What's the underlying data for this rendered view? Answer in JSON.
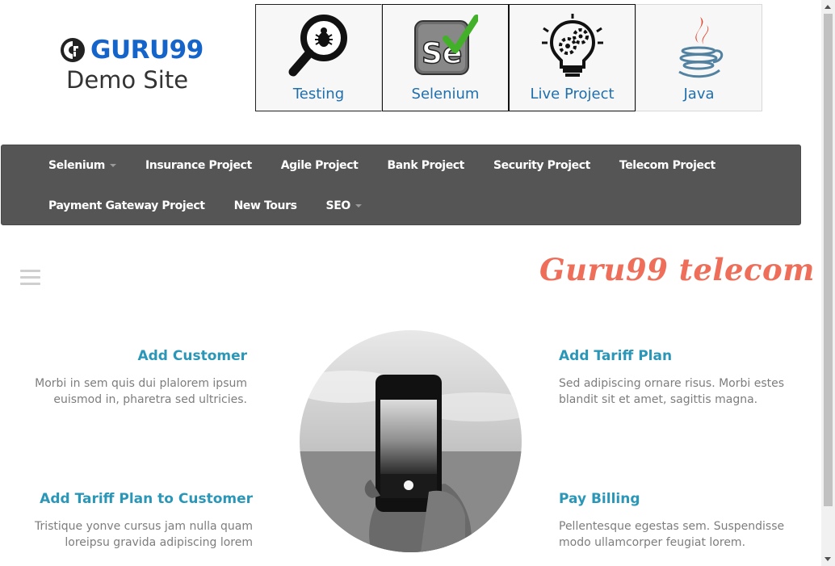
{
  "header": {
    "brand": "GURU99",
    "subtitle": "Demo Site",
    "brand_color": "#1564c9"
  },
  "tiles": [
    {
      "label": "Testing",
      "icon": "magnifier-bug-icon"
    },
    {
      "label": "Selenium",
      "icon": "selenium-logo-icon"
    },
    {
      "label": "Live Project",
      "icon": "lightbulb-gears-icon"
    },
    {
      "label": "Java",
      "icon": "java-logo-icon"
    }
  ],
  "nav": {
    "row1": [
      "Selenium",
      "Insurance Project",
      "Agile Project",
      "Bank Project",
      "Security Project",
      "Telecom Project"
    ],
    "row2": [
      "Payment Gateway Project",
      "New Tours",
      "SEO"
    ],
    "background": "#555555"
  },
  "main": {
    "title": "Guru99 telecom",
    "title_color": "#ee6e5a",
    "features": [
      {
        "title": "Add Customer",
        "text": "Morbi in sem quis dui plalorem ipsum euismod in, pharetra sed ultricies."
      },
      {
        "title": "Add Tariff Plan",
        "text": "Sed adipiscing ornare risus. Morbi estes blandit sit et amet, sagittis magna."
      },
      {
        "title": "Add Tariff Plan to Customer",
        "text": "Tristique yonve cursus jam nulla quam loreipsu gravida adipiscing lorem"
      },
      {
        "title": "Pay Billing",
        "text": "Pellentesque egestas sem. Suspendisse modo ullamcorper feugiat lorem."
      }
    ],
    "accent": "#2b97b8"
  }
}
